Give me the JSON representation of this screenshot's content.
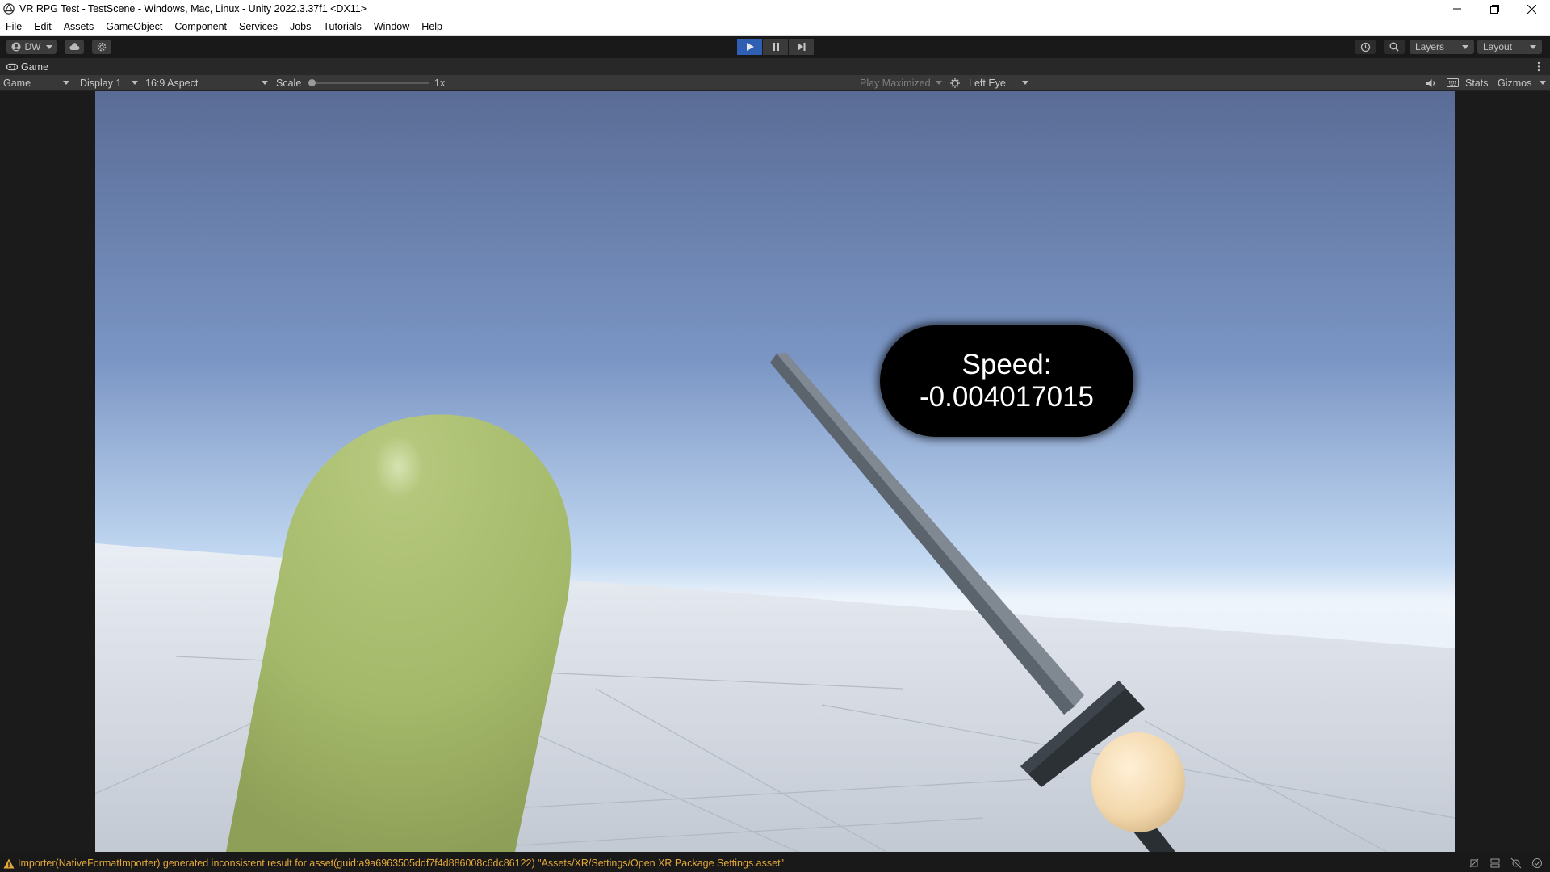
{
  "window": {
    "title": "VR RPG Test - TestScene - Windows, Mac, Linux - Unity 2022.3.37f1 <DX11>"
  },
  "menu": [
    "File",
    "Edit",
    "Assets",
    "GameObject",
    "Component",
    "Services",
    "Jobs",
    "Tutorials",
    "Window",
    "Help"
  ],
  "toolbar": {
    "account_label": "DW",
    "layers_label": "Layers",
    "layout_label": "Layout",
    "play_state": "playing"
  },
  "tab": {
    "label": "Game"
  },
  "game_toolbar": {
    "view_mode": "Game",
    "display": "Display 1",
    "aspect": "16:9 Aspect",
    "scale_label": "Scale",
    "scale_value": "1x",
    "scale_level": 0,
    "play_mode": "Play Maximized",
    "eye": "Left Eye",
    "stats_label": "Stats",
    "gizmos_label": "Gizmos"
  },
  "scene": {
    "speed_label": "Speed:",
    "speed_value": "-0.004017015"
  },
  "status": {
    "message": "Importer(NativeFormatImporter) generated inconsistent result for asset(guid:a9a6963505ddf7f4d886008c6dc86122) \"Assets/XR/Settings/Open XR Package Settings.asset\""
  },
  "colors": {
    "accent_play": "#2f5fb3",
    "warning": "#e4a83a",
    "capsule": "#a6bb6c",
    "sword_blade": "#6b7480",
    "sword_guard": "#3b4046",
    "hand": "#f0d6aa"
  }
}
